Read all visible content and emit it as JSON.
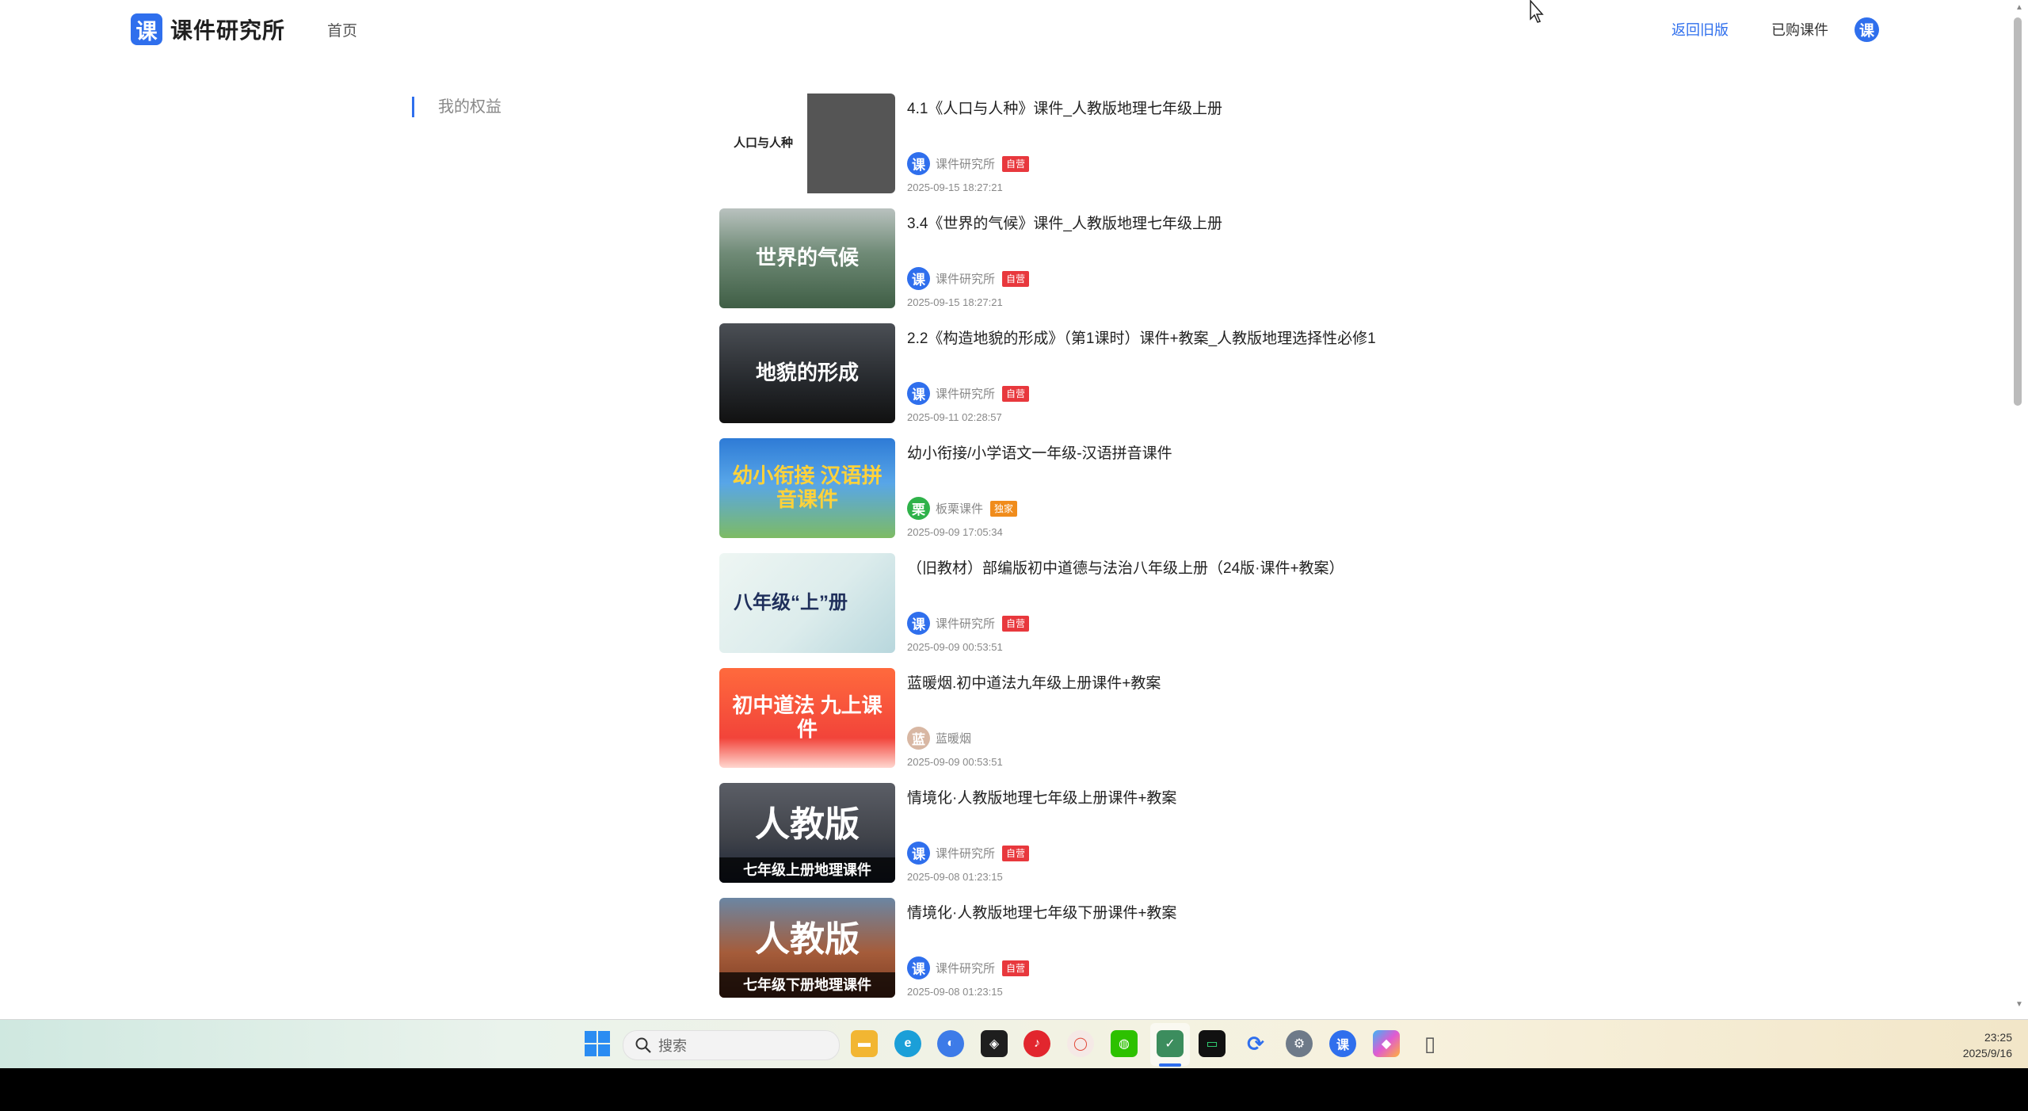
{
  "header": {
    "logo_mark": "课",
    "logo_text": "课件研究所",
    "nav_home": "首页",
    "nav_back": "返回旧版",
    "nav_bought": "已购课件",
    "avatar": "课"
  },
  "sidebar": {
    "items": [
      {
        "label": "我的权益"
      }
    ]
  },
  "list": {
    "items": [
      {
        "thumb_text": "人口与人种",
        "title": "4.1《人口与人种》课件_人教版地理七年级上册",
        "author": "课件研究所",
        "avatar": "课",
        "avatar_color": "#2f6fed",
        "badge": "自营",
        "badge_color": "#e8383d",
        "date": "2025-09-15 18:27:21"
      },
      {
        "thumb_text": "世界的气候",
        "title": "3.4《世界的气候》课件_人教版地理七年级上册",
        "author": "课件研究所",
        "avatar": "课",
        "avatar_color": "#2f6fed",
        "badge": "自营",
        "badge_color": "#e8383d",
        "date": "2025-09-15 18:27:21"
      },
      {
        "thumb_text": "地貌的形成",
        "title": "2.2《构造地貌的形成》（第1课时）课件+教案_人教版地理选择性必修1",
        "author": "课件研究所",
        "avatar": "课",
        "avatar_color": "#2f6fed",
        "badge": "自营",
        "badge_color": "#e8383d",
        "date": "2025-09-11 02:28:57"
      },
      {
        "thumb_text": "幼小衔接 汉语拼音课件",
        "title": "幼小衔接/小学语文一年级-汉语拼音课件",
        "author": "板栗课件",
        "avatar": "栗",
        "avatar_color": "#2fb24a",
        "badge": "独家",
        "badge_color": "#f08c1c",
        "date": "2025-09-09 17:05:34"
      },
      {
        "thumb_text": "八年级“上”册",
        "title": "（旧教材）部编版初中道德与法治八年级上册（24版·课件+教案）",
        "author": "课件研究所",
        "avatar": "课",
        "avatar_color": "#2f6fed",
        "badge": "自营",
        "badge_color": "#e8383d",
        "date": "2025-09-09 00:53:51"
      },
      {
        "thumb_text": "初中道法 九上课件",
        "title": "蓝暖烟.初中道法九年级上册课件+教案",
        "author": "蓝暖烟",
        "avatar": "蓝",
        "avatar_color": "#d8b7a3",
        "badge": "",
        "badge_color": "",
        "date": "2025-09-09 00:53:51"
      },
      {
        "thumb_text": "人教版",
        "thumb_band": "七年级上册地理课件",
        "title": "情境化·人教版地理七年级上册课件+教案",
        "author": "课件研究所",
        "avatar": "课",
        "avatar_color": "#2f6fed",
        "badge": "自营",
        "badge_color": "#e8383d",
        "date": "2025-09-08 01:23:15"
      },
      {
        "thumb_text": "人教版",
        "thumb_band": "七年级下册地理课件",
        "title": "情境化·人教版地理七年级下册课件+教案",
        "author": "课件研究所",
        "avatar": "课",
        "avatar_color": "#2f6fed",
        "badge": "自营",
        "badge_color": "#e8383d",
        "date": "2025-09-08 01:23:15"
      }
    ]
  },
  "taskbar": {
    "search_placeholder": "搜索",
    "icons": [
      "file-explorer-icon",
      "edge-icon",
      "browser-icon",
      "figma-icon",
      "netease-music-icon",
      "chat-icon",
      "wechat-icon",
      "courseware-app-icon",
      "terminal-icon",
      "sync-icon",
      "settings-icon",
      "kejian-icon",
      "copilot-icon",
      "phone-icon"
    ],
    "time": "23:25",
    "date": "2025/9/16"
  }
}
